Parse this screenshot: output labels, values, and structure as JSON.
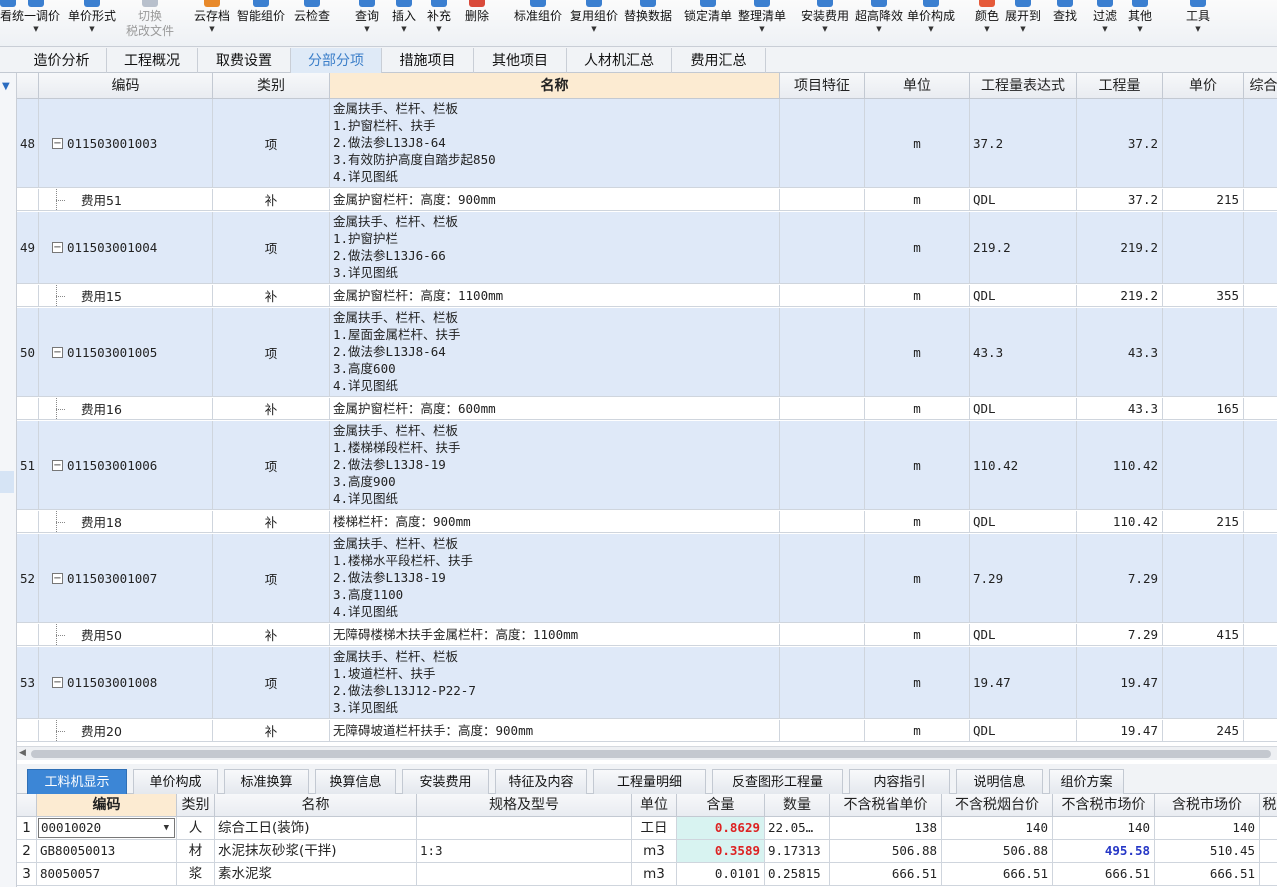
{
  "toolbar": {
    "items": [
      {
        "label": "看",
        "icon": "view-icon",
        "arrow": false
      },
      {
        "label": "统一调价",
        "icon": "unified-price-icon",
        "arrow": true
      },
      {
        "label": "单价形式",
        "icon": "unit-price-form-icon",
        "arrow": true
      },
      {
        "label": "切换",
        "sub": "税改文件",
        "icon": "switch-icon",
        "arrow": false,
        "disabled": true
      },
      {
        "label": "云存档",
        "icon": "cloud-archive-icon",
        "arrow": true
      },
      {
        "label": "智能组价",
        "icon": "smart-price-icon",
        "arrow": false
      },
      {
        "label": "云检查",
        "icon": "cloud-check-icon",
        "arrow": false
      },
      {
        "label": "查询",
        "icon": "query-icon",
        "arrow": true
      },
      {
        "label": "插入",
        "icon": "insert-icon",
        "arrow": true
      },
      {
        "label": "补充",
        "icon": "supplement-icon",
        "arrow": true
      },
      {
        "label": "删除",
        "icon": "delete-icon",
        "arrow": false
      },
      {
        "label": "标准组价",
        "icon": "standard-price-icon",
        "arrow": false
      },
      {
        "label": "复用组价",
        "icon": "reuse-price-icon",
        "arrow": true
      },
      {
        "label": "替换数据",
        "icon": "replace-data-icon",
        "arrow": false
      },
      {
        "label": "锁定清单",
        "icon": "lock-list-icon",
        "arrow": false
      },
      {
        "label": "整理清单",
        "icon": "organize-list-icon",
        "arrow": true
      },
      {
        "label": "安装费用",
        "icon": "install-fee-icon",
        "arrow": true
      },
      {
        "label": "超高降效",
        "icon": "height-reduce-icon",
        "arrow": true
      },
      {
        "label": "单价构成",
        "icon": "price-composition-icon",
        "arrow": true
      },
      {
        "label": "颜色",
        "icon": "color-icon",
        "arrow": true
      },
      {
        "label": "展开到",
        "icon": "expand-to-icon",
        "arrow": true
      },
      {
        "label": "查找",
        "icon": "find-icon",
        "arrow": false
      },
      {
        "label": "过滤",
        "icon": "filter-icon",
        "arrow": true
      },
      {
        "label": "其他",
        "icon": "other-icon",
        "arrow": true
      },
      {
        "label": "工具",
        "icon": "tools-icon",
        "arrow": true
      }
    ]
  },
  "tabs": [
    "造价分析",
    "工程概况",
    "取费设置",
    "分部分项",
    "措施项目",
    "其他项目",
    "人材机汇总",
    "费用汇总"
  ],
  "active_tab": "分部分项",
  "main_table": {
    "headers": [
      "编码",
      "类别",
      "名称",
      "项目特征",
      "单位",
      "工程量表达式",
      "工程量",
      "单价",
      "综合"
    ],
    "rows": [
      {
        "type": "main",
        "num": "48",
        "code": "011503001003",
        "cat": "项",
        "name": "金属扶手、栏杆、栏板\n1.护窗栏杆、扶手\n2.做法参L13J8-64\n3.有效防护高度自踏步起850\n4.详见图纸",
        "unit": "m",
        "expr": "37.2",
        "qty": "37.2",
        "price": ""
      },
      {
        "type": "sub",
        "num": "",
        "code": "费用51",
        "cat": "补",
        "name": "金属护窗栏杆：高度：900mm",
        "unit": "m",
        "expr": "QDL",
        "qty": "37.2",
        "price": "215"
      },
      {
        "type": "main",
        "num": "49",
        "code": "011503001004",
        "cat": "项",
        "name": "金属扶手、栏杆、栏板\n1.护窗护栏\n2.做法参L13J6-66\n3.详见图纸",
        "unit": "m",
        "expr": "219.2",
        "qty": "219.2",
        "price": ""
      },
      {
        "type": "sub",
        "num": "",
        "code": "费用15",
        "cat": "补",
        "name": "金属护窗栏杆：高度：1100mm",
        "unit": "m",
        "expr": "QDL",
        "qty": "219.2",
        "price": "355"
      },
      {
        "type": "main",
        "num": "50",
        "code": "011503001005",
        "cat": "项",
        "name": "金属扶手、栏杆、栏板\n1.屋面金属栏杆、扶手\n2.做法参L13J8-64\n3.高度600\n4.详见图纸",
        "unit": "m",
        "expr": "43.3",
        "qty": "43.3",
        "price": ""
      },
      {
        "type": "sub",
        "num": "",
        "code": "费用16",
        "cat": "补",
        "name": "金属护窗栏杆：高度：600mm",
        "unit": "m",
        "expr": "QDL",
        "qty": "43.3",
        "price": "165"
      },
      {
        "type": "main",
        "num": "51",
        "code": "011503001006",
        "cat": "项",
        "name": "金属扶手、栏杆、栏板\n1.楼梯梯段栏杆、扶手\n2.做法参L13J8-19\n3.高度900\n4.详见图纸",
        "unit": "m",
        "expr": "110.42",
        "qty": "110.42",
        "price": ""
      },
      {
        "type": "sub",
        "num": "",
        "code": "费用18",
        "cat": "补",
        "name": "楼梯栏杆：高度：900mm",
        "unit": "m",
        "expr": "QDL",
        "qty": "110.42",
        "price": "215"
      },
      {
        "type": "main",
        "num": "52",
        "code": "011503001007",
        "cat": "项",
        "name": "金属扶手、栏杆、栏板\n1.楼梯水平段栏杆、扶手\n2.做法参L13J8-19\n3.高度1100\n4.详见图纸",
        "unit": "m",
        "expr": "7.29",
        "qty": "7.29",
        "price": ""
      },
      {
        "type": "sub",
        "num": "",
        "code": "费用50",
        "cat": "补",
        "name": "无障碍楼梯木扶手金属栏杆：高度：1100mm",
        "unit": "m",
        "expr": "QDL",
        "qty": "7.29",
        "price": "415"
      },
      {
        "type": "main",
        "num": "53",
        "code": "011503001008",
        "cat": "项",
        "name": "金属扶手、栏杆、栏板\n1.坡道栏杆、扶手\n2.做法参L13J12-P22-7\n3.详见图纸",
        "unit": "m",
        "expr": "19.47",
        "qty": "19.47",
        "price": ""
      },
      {
        "type": "sub",
        "num": "",
        "code": "费用20",
        "cat": "补",
        "name": "无障碍坡道栏杆扶手：高度：900mm",
        "unit": "m",
        "expr": "QDL",
        "qty": "19.47",
        "price": "245"
      }
    ]
  },
  "bottom_tabs": [
    "工料机显示",
    "单价构成",
    "标准换算",
    "换算信息",
    "安装费用",
    "特征及内容",
    "工程量明细",
    "反查图形工程量",
    "内容指引",
    "说明信息",
    "组价方案"
  ],
  "active_bottom_tab": "工料机显示",
  "resource_table": {
    "headers": [
      "编码",
      "类别",
      "名称",
      "规格及型号",
      "单位",
      "含量",
      "数量",
      "不含税省单价",
      "不含税烟台价",
      "不含税市场价",
      "含税市场价",
      "税"
    ],
    "rows": [
      {
        "num": "1",
        "code": "00010020",
        "cat": "人",
        "name": "综合工日(装饰)",
        "spec": "",
        "unit": "工日",
        "content": "0.8629",
        "qty": "22.05…",
        "p1": "138",
        "p2": "140",
        "p3": "140",
        "p4": "140"
      },
      {
        "num": "2",
        "code": "GB80050013",
        "cat": "材",
        "name": "水泥抹灰砂浆(干拌)",
        "spec": "1:3",
        "unit": "m3",
        "content": "0.3589",
        "qty": "9.17313",
        "p1": "506.88",
        "p2": "506.88",
        "p3": "495.58",
        "p4": "510.45"
      },
      {
        "num": "3",
        "code": "80050057",
        "cat": "浆",
        "name": "素水泥浆",
        "spec": "",
        "unit": "m3",
        "content": "0.0101",
        "qty": "0.25815",
        "p1": "666.51",
        "p2": "666.51",
        "p3": "666.51",
        "p4": "666.51"
      }
    ]
  },
  "colors": {
    "main_row": "#dfe9f8",
    "active_tab_text": "#3c7fc9",
    "active_bottom_tab": "#3c86d6",
    "highlight_red": "#dd2222",
    "highlight_blue": "#2637c6"
  }
}
